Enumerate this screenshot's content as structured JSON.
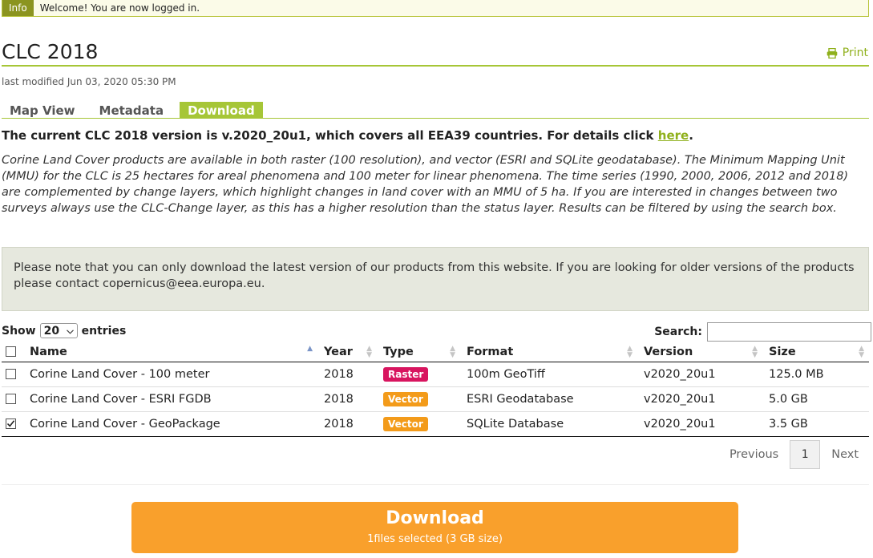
{
  "info": {
    "tag": "Info",
    "message": "Welcome! You are now logged in."
  },
  "page": {
    "title": "CLC 2018",
    "print_label": "Print",
    "modified": "last modified Jun 03, 2020 05:30 PM"
  },
  "tabs": [
    {
      "label": "Map View",
      "active": false
    },
    {
      "label": "Metadata",
      "active": false
    },
    {
      "label": "Download",
      "active": true
    }
  ],
  "lead": {
    "text": "The current CLC 2018 version is v.2020_20u1, which covers all EEA39 countries. For details click ",
    "link": "here",
    "end": "."
  },
  "description": "Corine Land Cover products are available in both raster (100 resolution), and vector (ESRI and SQLite geodatabase). The Minimum Mapping Unit (MMU) for the CLC is 25 hectares for areal phenomena and 100 meter for linear phenomena. The time series (1990, 2000, 2006, 2012 and 2018) are complemented by change layers, which highlight changes in land cover with an MMU of 5 ha. If you are interested in changes between two surveys always use the CLC-Change layer, as this has a higher resolution than the status layer. Results can be filtered by using the search box.",
  "note": "Please note that you can only download the latest version of our products from this website. If you are looking for older versions of the products please contact copernicus@eea.europa.eu.",
  "controls": {
    "show_label": "Show",
    "entries_value": "20",
    "entries_label": "entries",
    "search_label": "Search:",
    "search_value": ""
  },
  "table": {
    "headers": [
      "Name",
      "Year",
      "Type",
      "Format",
      "Version",
      "Size"
    ],
    "rows": [
      {
        "checked": false,
        "name": "Corine Land Cover - 100 meter",
        "year": "2018",
        "type": "Raster",
        "format": "100m GeoTiff",
        "version": "v2020_20u1",
        "size": "125.0 MB"
      },
      {
        "checked": false,
        "name": "Corine Land Cover - ESRI FGDB",
        "year": "2018",
        "type": "Vector",
        "format": "ESRI Geodatabase",
        "version": "v2020_20u1",
        "size": "5.0 GB"
      },
      {
        "checked": true,
        "name": "Corine Land Cover - GeoPackage",
        "year": "2018",
        "type": "Vector",
        "format": "SQLite Database",
        "version": "v2020_20u1",
        "size": "3.5 GB"
      }
    ]
  },
  "pagination": {
    "previous": "Previous",
    "current": "1",
    "next": "Next"
  },
  "download": {
    "title": "Download",
    "subtitle": "1files selected (3 GB size)"
  },
  "colors": {
    "accent": "#a6c637",
    "link": "#8fb01b",
    "raster_badge": "#d8155f",
    "vector_badge": "#f39b1a",
    "download_button": "#f9a02c"
  }
}
